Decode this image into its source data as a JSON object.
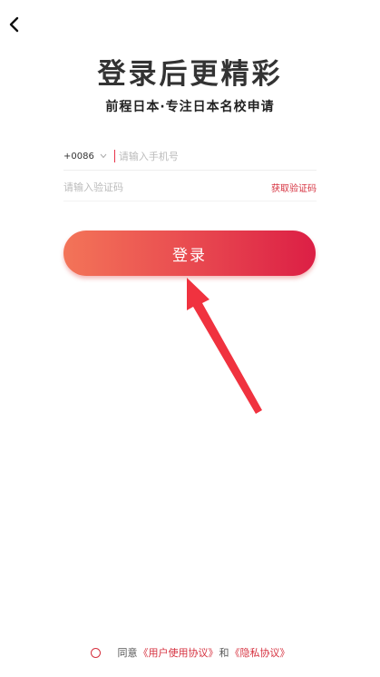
{
  "header": {
    "back_icon": "chevron-left-icon"
  },
  "hero": {
    "title": "登录后更精彩",
    "subtitle": "前程日本·专注日本名校申请"
  },
  "form": {
    "country_code": "+0086",
    "phone_placeholder": "请输入手机号",
    "code_placeholder": "请输入验证码",
    "get_code_label": "获取验证码"
  },
  "login": {
    "label": "登录"
  },
  "agreement": {
    "prefix": "同意",
    "user_agreement": "《用户使用协议》",
    "conjunction": "和",
    "privacy_policy": "《隐私协议》"
  },
  "colors": {
    "accent": "#d6313f",
    "button_gradient_start": "#f37458",
    "button_gradient_end": "#dc1f45",
    "annotation_arrow": "#f0323f"
  }
}
